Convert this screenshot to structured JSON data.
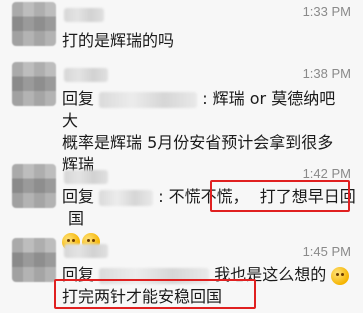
{
  "messages": [
    {
      "time": "1:33 PM",
      "text": "打的是辉瑞的吗"
    },
    {
      "time": "1:38 PM",
      "reply_prefix": "回复",
      "line1_tail": ": 辉瑞 or 莫德纳吧 大",
      "line2": "概率是辉瑞 5月份安省预计会拿到很多",
      "line3": "辉瑞"
    },
    {
      "time": "1:42 PM",
      "reply_prefix": "回复",
      "after_name": ": 不慌不慌，",
      "highlight": "打了想早日回国",
      "emoji_names": [
        "thinking-face",
        "thinking-face"
      ]
    },
    {
      "time": "1:45 PM",
      "reply_prefix": "回复",
      "after_name": "我也是这么想的",
      "emoji_name": "laughing-face",
      "highlight": "打完两针才能安稳回国"
    }
  ],
  "colors": {
    "background": "#f7f7f7",
    "highlight_border": "#e02020",
    "time_text": "#8a8a8a"
  }
}
